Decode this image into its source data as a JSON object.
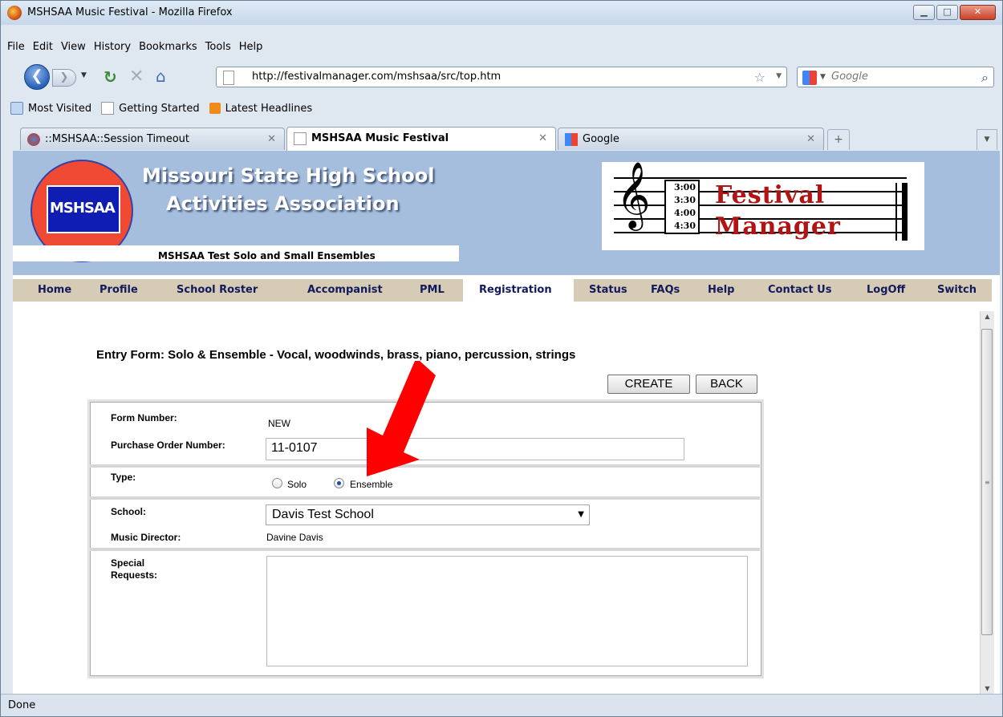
{
  "window": {
    "title": "MSHSAA Music Festival - Mozilla Firefox"
  },
  "menu": [
    "File",
    "Edit",
    "View",
    "History",
    "Bookmarks",
    "Tools",
    "Help"
  ],
  "toolbar": {
    "url": "http://festivalmanager.com/mshsaa/src/top.htm",
    "search_placeholder": "Google"
  },
  "bookmarks": [
    "Most Visited",
    "Getting Started",
    "Latest Headlines"
  ],
  "tabs": [
    {
      "label": "::MSHSAA::Session Timeout",
      "active": false
    },
    {
      "label": "MSHSAA Music Festival",
      "active": true
    },
    {
      "label": "Google",
      "active": false
    }
  ],
  "banner": {
    "org_line1": "Missouri State High School",
    "org_line2": "Activities Association",
    "logo_text": "MSHSAA",
    "festival_name": "MSHSAA Test Solo and Small Ensembles",
    "times": [
      "3:00",
      "3:30",
      "4:00",
      "4:30"
    ],
    "product_line1": "Festival",
    "product_line2": "Manager"
  },
  "nav": [
    {
      "label": "Home"
    },
    {
      "label": "Profile"
    },
    {
      "label": "School Roster"
    },
    {
      "label": "Accompanist"
    },
    {
      "label": "PML"
    },
    {
      "label": "Registration"
    },
    {
      "label": "Status"
    },
    {
      "label": "FAQs"
    },
    {
      "label": "Help"
    },
    {
      "label": "Contact Us"
    },
    {
      "label": "LogOff"
    },
    {
      "label": "Switch"
    }
  ],
  "form": {
    "heading": "Entry Form: Solo & Ensemble - Vocal, woodwinds, brass, piano, percussion, strings",
    "create_label": "CREATE",
    "back_label": "BACK",
    "form_number_label": "Form Number:",
    "form_number_value": "NEW",
    "po_label": "Purchase Order Number:",
    "po_value": "11-0107",
    "type_label": "Type:",
    "type_options": [
      "Solo",
      "Ensemble"
    ],
    "type_selected": "Ensemble",
    "school_label": "School:",
    "school_value": "Davis Test School",
    "director_label": "Music Director:",
    "director_value": "Davine Davis",
    "special_label_1": "Special",
    "special_label_2": "Requests:",
    "special_value": ""
  },
  "status": {
    "text": "Done"
  },
  "colors": {
    "annotation_arrow": "#ff0000",
    "nav_bg": "#d6ccb6",
    "banner_bg": "#a6bedd",
    "brand_red": "#b21414"
  }
}
